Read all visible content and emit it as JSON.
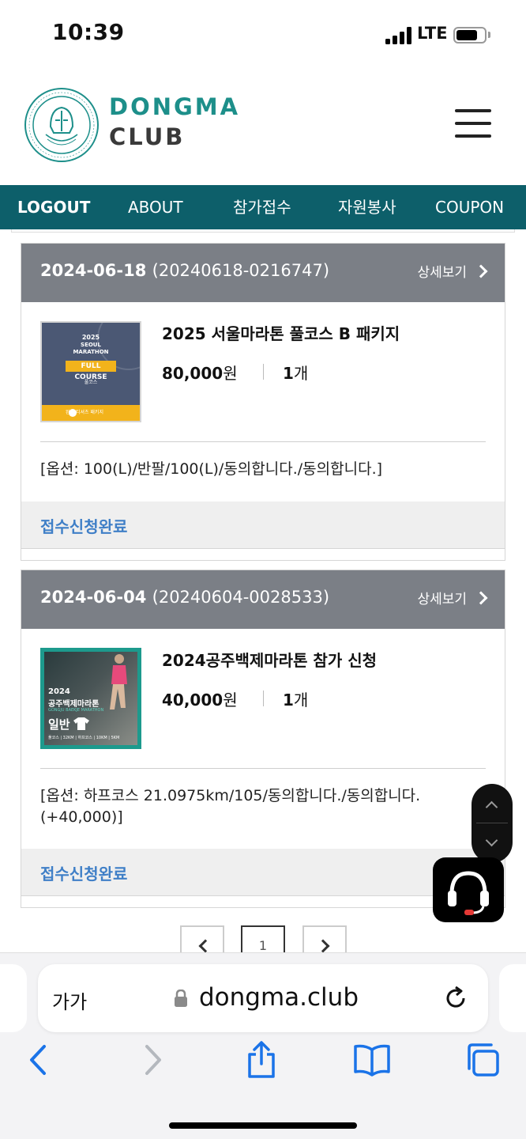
{
  "status_bar": {
    "time": "10:39",
    "network": "LTE",
    "battery_level": 0.75
  },
  "site": {
    "logo_line1": "DONGMA",
    "logo_line2": "CLUB",
    "colors": {
      "teal": "#1d8f8a",
      "nav_bg": "#0d5f6a",
      "status_blue": "#3f7fc7",
      "card_header": "#7b7f86"
    }
  },
  "nav": {
    "items": [
      "LOGOUT",
      "ABOUT",
      "참가접수",
      "자원봉사",
      "COUPON"
    ]
  },
  "orders": [
    {
      "date": "2024-06-18",
      "order_id": "(20240618-0216747)",
      "detail_label": "상세보기",
      "product_name": "2025 서울마라톤 풀코스 B 패키지",
      "price": "80,000",
      "price_unit": "원",
      "qty": "1",
      "qty_unit": "개",
      "options": "[옵션: 100(L)/반팔/100(L)/동의합니다./동의합니다.]",
      "status": "접수신청완료",
      "thumb": {
        "year": "2025",
        "title_line1": "SEOUL",
        "title_line2": "MARATHON",
        "course": "FULL COURSE",
        "course_ko": "풀코스",
        "bar_text": "완주 티셔츠 패키지"
      }
    },
    {
      "date": "2024-06-04",
      "order_id": "(20240604-0028533)",
      "detail_label": "상세보기",
      "product_name": "2024공주백제마라톤 참가 신청",
      "price": "40,000",
      "price_unit": "원",
      "qty": "1",
      "qty_unit": "개",
      "options": "[옵션: 하프코스 21.0975km/105/동의합니다./동의합니다. (+40,000)]",
      "status": "접수신청완료",
      "thumb": {
        "year": "2024",
        "title": "공주백제마라톤",
        "title_en": "GONGJU BAEKJE MARATHON",
        "badge": "일반",
        "foot": "풀코스 | 32KM | 하프코스 | 10KM | 5KM"
      }
    }
  ],
  "pagination": {
    "current": "1"
  },
  "browser": {
    "text_size": "가가",
    "url": "dongma.club"
  }
}
